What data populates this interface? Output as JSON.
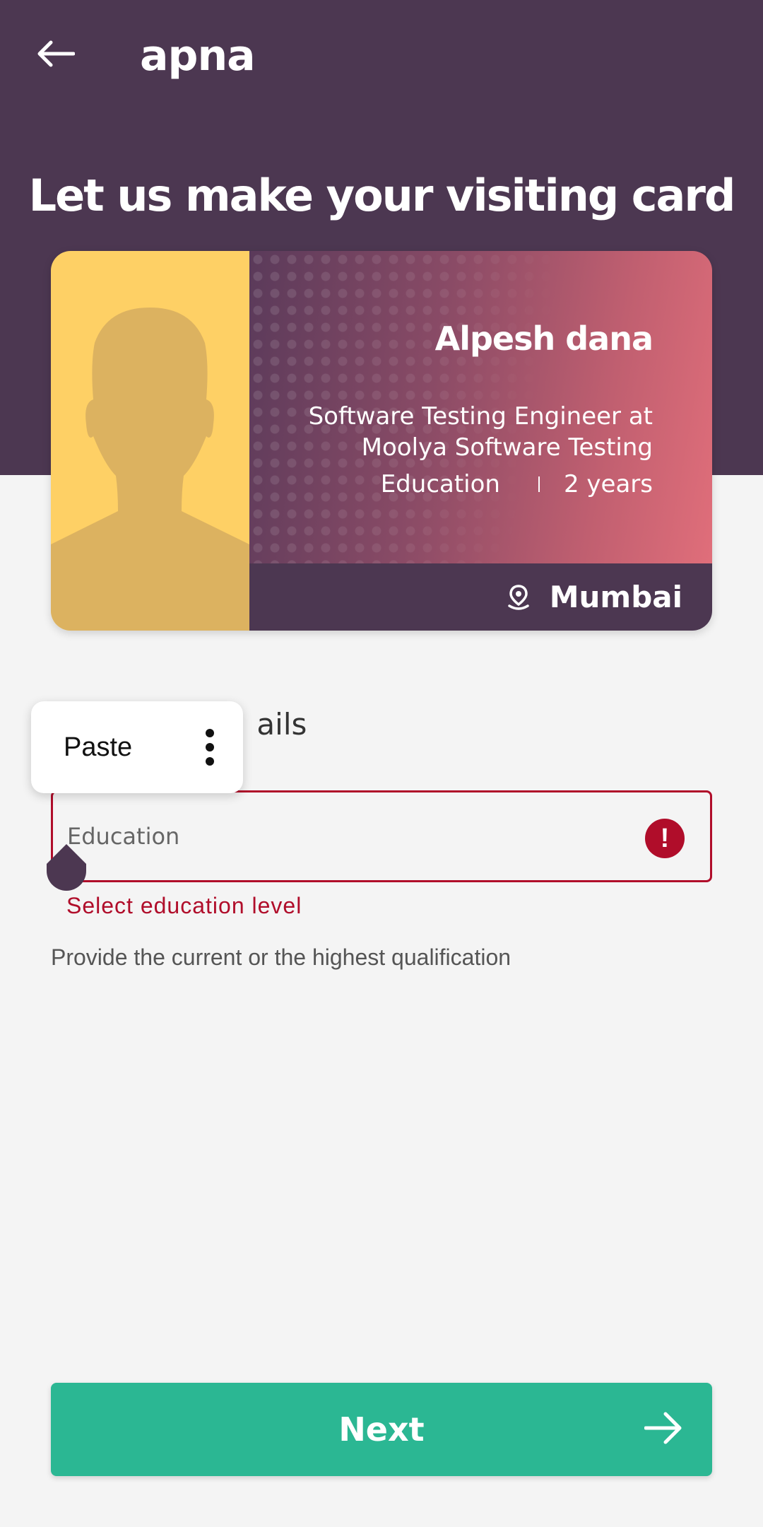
{
  "app": {
    "brand": "apna"
  },
  "header": {
    "back_icon": "arrow-left-icon",
    "title": "Let us make your visiting card"
  },
  "card": {
    "name": "Alpesh dana",
    "role": "Software Testing Engineer at Moolya Software Testing",
    "education": "Education",
    "experience": "2 years",
    "location": "Mumbai",
    "location_icon": "location-pin-icon",
    "photo_icon": "person-silhouette-icon"
  },
  "form": {
    "section_heading": "Education details",
    "section_heading_visible": "ails",
    "education_placeholder": "Education",
    "error_message": "Select education level",
    "helper_text": "Provide the current or the highest qualification"
  },
  "context_menu": {
    "paste_label": "Paste",
    "more_icon": "more-vertical-icon"
  },
  "footer": {
    "next_label": "Next",
    "next_icon": "arrow-right-icon"
  },
  "colors": {
    "header_bg": "#4c3751",
    "accent_green": "#2bb793",
    "error_red": "#b00d2a",
    "photo_bg": "#fed065"
  }
}
